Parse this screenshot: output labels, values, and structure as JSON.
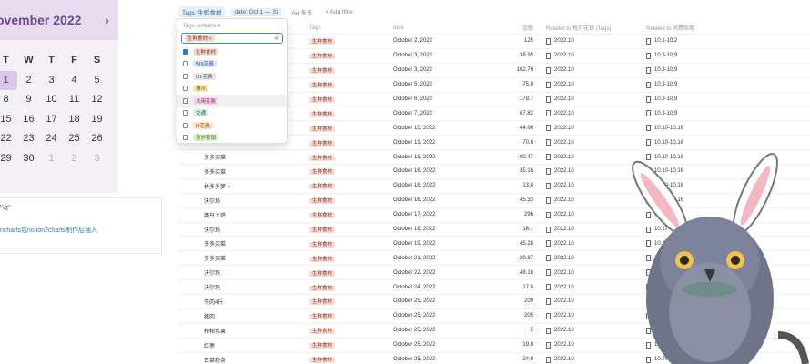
{
  "calendar": {
    "title": "ovember 2022",
    "next_icon": "chevron-right-icon",
    "weekdays": [
      "T",
      "W",
      "T",
      "F",
      "S"
    ],
    "weeks": [
      [
        "1",
        "2",
        "3",
        "4",
        "5"
      ],
      [
        "8",
        "9",
        "10",
        "11",
        "12"
      ],
      [
        "15",
        "16",
        "17",
        "18",
        "19"
      ],
      [
        "22",
        "23",
        "24",
        "25",
        "26"
      ],
      [
        "29",
        "30",
        "1",
        "2",
        "3"
      ]
    ],
    "highlight_date": "1"
  },
  "note": {
    "top_text": "\"ᐛ\"",
    "link_text": "ncharts或notion2charts制作后插入"
  },
  "toolbar": {
    "filter1": "Tags: 生鲜食材",
    "filter2": "date: Oct 1 — 31",
    "filter3": "Aa 多多",
    "add_filter": "+ Add filter"
  },
  "table": {
    "headers": [
      "",
      "Tags",
      "date",
      "金额",
      "Related to 每月花销 (Tags)",
      "Related to 消费周期"
    ],
    "rows": [
      {
        "name": "",
        "tag": "生鲜食材",
        "date": "October 2, 2022",
        "amount": "125",
        "month": "2022.10",
        "period": "10.1-10.2"
      },
      {
        "name": "",
        "tag": "生鲜食材",
        "date": "October 3, 2022",
        "amount": "38.95",
        "month": "2022.10",
        "period": "10.3-10.9"
      },
      {
        "name": "",
        "tag": "生鲜食材",
        "date": "October 3, 2022",
        "amount": "102.76",
        "month": "2022.10",
        "period": "10.3-10.9"
      },
      {
        "name": "",
        "tag": "生鲜食材",
        "date": "October 5, 2022",
        "amount": "75.9",
        "month": "2022.10",
        "period": "10.3-10.9"
      },
      {
        "name": "",
        "tag": "生鲜食材",
        "date": "October 6, 2022",
        "amount": "178.7",
        "month": "2022.10",
        "period": "10.3-10.9"
      },
      {
        "name": "",
        "tag": "生鲜食材",
        "date": "October 7, 2022",
        "amount": "67.82",
        "month": "2022.10",
        "period": "10.3-10.9"
      },
      {
        "name": "",
        "tag": "生鲜食材",
        "date": "October 10, 2022",
        "amount": "44.96",
        "month": "2022.10",
        "period": "10.10-10.16"
      },
      {
        "name": "",
        "tag": "生鲜食材",
        "date": "October 13, 2022",
        "amount": "70.6",
        "month": "2022.10",
        "period": "10.10-10.16"
      },
      {
        "name": "多多买菜",
        "tag": "生鲜食材",
        "date": "October 13, 2022",
        "amount": "80.47",
        "month": "2022.10",
        "period": "10.10-10.16"
      },
      {
        "name": "多多买菜",
        "tag": "生鲜食材",
        "date": "October 16, 2022",
        "amount": "35.16",
        "month": "2022.10",
        "period": "10.10-10.16"
      },
      {
        "name": "拼多多萝卜",
        "tag": "生鲜食材",
        "date": "October 16, 2022",
        "amount": "13.8",
        "month": "2022.10",
        "period": "10.10-10.16"
      },
      {
        "name": "沃尔玛",
        "tag": "生鲜食材",
        "date": "October 16, 2022",
        "amount": "45.33",
        "month": "2022.10",
        "period": "10.10-10.16"
      },
      {
        "name": "两只土鸡",
        "tag": "生鲜食材",
        "date": "October 17, 2022",
        "amount": "296",
        "month": "2022.10",
        "period": "10.17-10.23"
      },
      {
        "name": "沃尔玛",
        "tag": "生鲜食材",
        "date": "October 18, 2022",
        "amount": "16.1",
        "month": "2022.10",
        "period": "10.17-10.23"
      },
      {
        "name": "多多买菜",
        "tag": "生鲜食材",
        "date": "October 19, 2022",
        "amount": "45.28",
        "month": "2022.10",
        "period": "10.17-10.23"
      },
      {
        "name": "多多买菜",
        "tag": "生鲜食材",
        "date": "October 21, 2022",
        "amount": "29.87",
        "month": "2022.10",
        "period": "10.17-10.23"
      },
      {
        "name": "沃尔玛",
        "tag": "生鲜食材",
        "date": "October 22, 2022",
        "amount": "48.18",
        "month": "2022.10",
        "period": "10.17-10.23"
      },
      {
        "name": "沃尔玛",
        "tag": "生鲜食材",
        "date": "October 24, 2022",
        "amount": "17.8",
        "month": "2022.10",
        "period": "10.24-10.30"
      },
      {
        "name": "牛肉4斤",
        "tag": "生鲜食材",
        "date": "October 25, 2022",
        "amount": "209",
        "month": "2022.10",
        "period": "10.24-10.30"
      },
      {
        "name": "猪肉",
        "tag": "生鲜食材",
        "date": "October 25, 2022",
        "amount": "205",
        "month": "2022.10",
        "period": "10.24-10.30"
      },
      {
        "name": "榨榨水果",
        "tag": "生鲜食材",
        "date": "October 25, 2022",
        "amount": "5",
        "month": "2022.10",
        "period": "10.24-10.30"
      },
      {
        "name": "红枣",
        "tag": "生鲜食材",
        "date": "October 25, 2022",
        "amount": "19.8",
        "month": "2022.10",
        "period": "10.24-10.30"
      },
      {
        "name": "白菜粉条",
        "tag": "生鲜食材",
        "date": "October 25, 2022",
        "amount": "24.9",
        "month": "2022.10",
        "period": "10.24-10.30"
      }
    ]
  },
  "dropdown": {
    "header": "Tags contains ▾",
    "more": "···",
    "selected_chip": "生鲜食材",
    "clear_icon": "clear-icon",
    "options": [
      {
        "label": "生鲜食材",
        "checked": true
      },
      {
        "label": "WS花费",
        "checked": false
      },
      {
        "label": "LIL花费",
        "checked": false
      },
      {
        "label": "通讯",
        "checked": false
      },
      {
        "label": "共用花费",
        "checked": false
      },
      {
        "label": "交通",
        "checked": false
      },
      {
        "label": "LI花费",
        "checked": false
      },
      {
        "label": "意外花销",
        "checked": false
      }
    ]
  }
}
